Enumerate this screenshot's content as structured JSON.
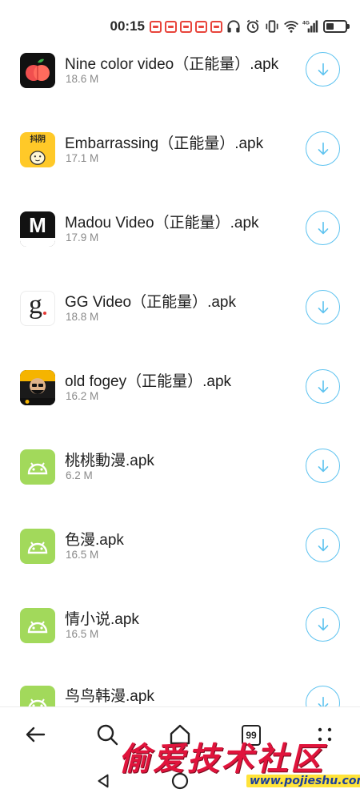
{
  "status_bar": {
    "time": "00:15",
    "notification_count": 5,
    "icons": [
      "headphones-icon",
      "alarm-icon",
      "vibrate-icon",
      "wifi-icon",
      "signal-4g-icon",
      "battery-icon"
    ],
    "network_label": "4G"
  },
  "files": [
    {
      "name": "Nine color video（正能量）.apk",
      "size": "18.6 M",
      "icon": "peach-app-icon"
    },
    {
      "name": "Embarrassing（正能量）.apk",
      "size": "17.1 M",
      "icon": "yellow-app-icon",
      "icon_text": "抖阴"
    },
    {
      "name": "Madou Video（正能量）.apk",
      "size": "17.9 M",
      "icon": "madou-app-icon",
      "icon_text": "M"
    },
    {
      "name": "GG Video（正能量）.apk",
      "size": "18.8 M",
      "icon": "gg-app-icon",
      "icon_text": "g"
    },
    {
      "name": "old fogey（正能量）.apk",
      "size": "16.2 M",
      "icon": "fogey-app-icon"
    },
    {
      "name": "桃桃動漫.apk",
      "size": "6.2 M",
      "icon": "android-icon"
    },
    {
      "name": "色漫.apk",
      "size": "16.5 M",
      "icon": "android-icon"
    },
    {
      "name": "情小说.apk",
      "size": "16.5 M",
      "icon": "android-icon"
    },
    {
      "name": "鸟鸟韩漫.apk",
      "size": "",
      "icon": "android-icon"
    }
  ],
  "bottom_nav": {
    "tabs_count": "99",
    "items": [
      "back-icon",
      "search-icon",
      "home-icon",
      "tabs-button",
      "more-icon"
    ]
  },
  "watermark": {
    "title": "偷爱技术社区",
    "url": "www.pojieshu.com"
  },
  "colors": {
    "accent": "#5ec3f0",
    "android_green": "#a2d95b",
    "notification_red": "#e8453c",
    "watermark_red": "#e0143c"
  }
}
